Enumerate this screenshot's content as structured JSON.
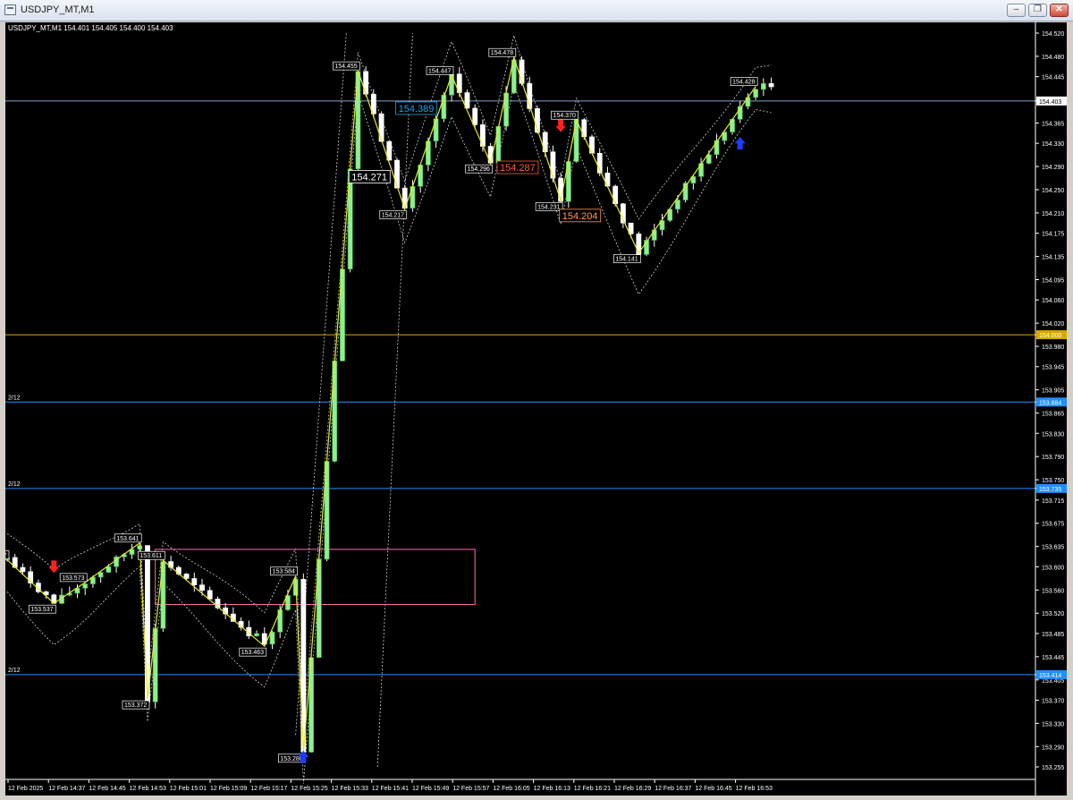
{
  "window": {
    "title": "USDJPY_MT,M1",
    "minimize_label": "–",
    "restore_label": "❐",
    "close_label": "✕"
  },
  "chart": {
    "header": "USDJPY_MT,M1  154.401 154.405 154.400 154.403",
    "colors": {
      "background": "#000000",
      "axis": "#ffffff",
      "bull": "#90ee90",
      "bear": "#ffffff",
      "zigzag": "#e6e62e",
      "level_gold": "#d7a800",
      "level_blue": "#1e90ff",
      "box": "#ff69b4"
    },
    "price_labels": [
      "154.520",
      "154.480",
      "154.445",
      "154.403",
      "154.365",
      "154.330",
      "154.290",
      "154.250",
      "154.210",
      "154.175",
      "154.135",
      "154.095",
      "154.060",
      "154.020",
      "154.000",
      "153.980",
      "153.945",
      "153.905",
      "153.884",
      "153.865",
      "153.830",
      "153.790",
      "153.750",
      "153.735",
      "153.715",
      "153.675",
      "153.635",
      "153.600",
      "153.560",
      "153.520",
      "153.485",
      "153.445",
      "153.414",
      "153.405",
      "153.370",
      "153.330",
      "153.290",
      "153.255"
    ],
    "time_labels": [
      "12 Feb 2025",
      "12 Feb 14:37",
      "12 Feb 14:45",
      "12 Feb 14:53",
      "12 Feb 15:01",
      "12 Feb 15:09",
      "12 Feb 15:17",
      "12 Feb 15:25",
      "12 Feb 15:33",
      "12 Feb 15:41",
      "12 Feb 15:49",
      "12 Feb 15:57",
      "12 Feb 16:05",
      "12 Feb 16:13",
      "12 Feb 16:21",
      "12 Feb 16:29",
      "12 Feb 16:37",
      "12 Feb 16:45",
      "12 Feb 16:53"
    ],
    "current_price": "154.403",
    "levels": [
      {
        "price": 154.0,
        "label": "154.000",
        "color": "#d7a800",
        "tag": ""
      },
      {
        "price": 153.884,
        "label": "153.884",
        "color": "#1e90ff",
        "tag": "2/12"
      },
      {
        "price": 153.735,
        "label": "153.735",
        "color": "#1e90ff",
        "tag": "2/12"
      },
      {
        "price": 153.414,
        "label": "153.414",
        "color": "#1e90ff",
        "tag": "2/12"
      }
    ],
    "zigzag": [
      {
        "t": 0,
        "p": 153.612,
        "label": "153.612"
      },
      {
        "t": 6,
        "p": 153.537,
        "label": "153.537"
      },
      {
        "t": 10,
        "p": 153.573,
        "label": "153.573"
      },
      {
        "t": 17,
        "p": 153.641,
        "label": "153.641"
      },
      {
        "t": 18,
        "p": 153.372,
        "label": "153.372"
      },
      {
        "t": 20,
        "p": 153.611,
        "label": "153.611"
      },
      {
        "t": 33,
        "p": 153.463,
        "label": "153.463"
      },
      {
        "t": 37,
        "p": 153.584,
        "label": "153.584"
      },
      {
        "t": 38,
        "p": 153.28,
        "label": "153.280"
      },
      {
        "t": 45,
        "p": 154.455,
        "label": "154.455"
      },
      {
        "t": 51,
        "p": 154.217,
        "label": "154.217"
      },
      {
        "t": 57,
        "p": 154.447,
        "label": "154.447"
      },
      {
        "t": 62,
        "p": 154.296,
        "label": "154.296"
      },
      {
        "t": 65,
        "p": 154.478,
        "label": "154.478"
      },
      {
        "t": 71,
        "p": 154.231,
        "label": "154.231"
      },
      {
        "t": 73,
        "p": 154.37,
        "label": "154.370"
      },
      {
        "t": 81,
        "p": 154.141,
        "label": "154.141"
      },
      {
        "t": 96,
        "p": 154.428,
        "label": "154.428"
      }
    ],
    "big_labels": [
      {
        "t": 55,
        "p": 154.389,
        "label": "154.389",
        "color": "#1ea0e0"
      },
      {
        "t": 49,
        "p": 154.271,
        "label": "154.271",
        "color": "#ffffff"
      },
      {
        "t": 68,
        "p": 154.287,
        "label": "154.287",
        "color": "#ff5a3c"
      },
      {
        "t": 76,
        "p": 154.204,
        "label": "154.204",
        "color": "#ff9a50"
      }
    ],
    "arrows": [
      {
        "t": 6,
        "p": 153.6,
        "dir": "down",
        "color": "#ff2020"
      },
      {
        "t": 71,
        "p": 154.36,
        "dir": "down",
        "color": "#ff2020"
      },
      {
        "t": 94,
        "p": 154.33,
        "dir": "up",
        "color": "#1e3cff"
      },
      {
        "t": 38,
        "p": 153.272,
        "dir": "up",
        "color": "#1e3cff"
      }
    ],
    "box": {
      "t1": 19,
      "t2": 60,
      "p1": 153.63,
      "p2": 153.535
    }
  }
}
